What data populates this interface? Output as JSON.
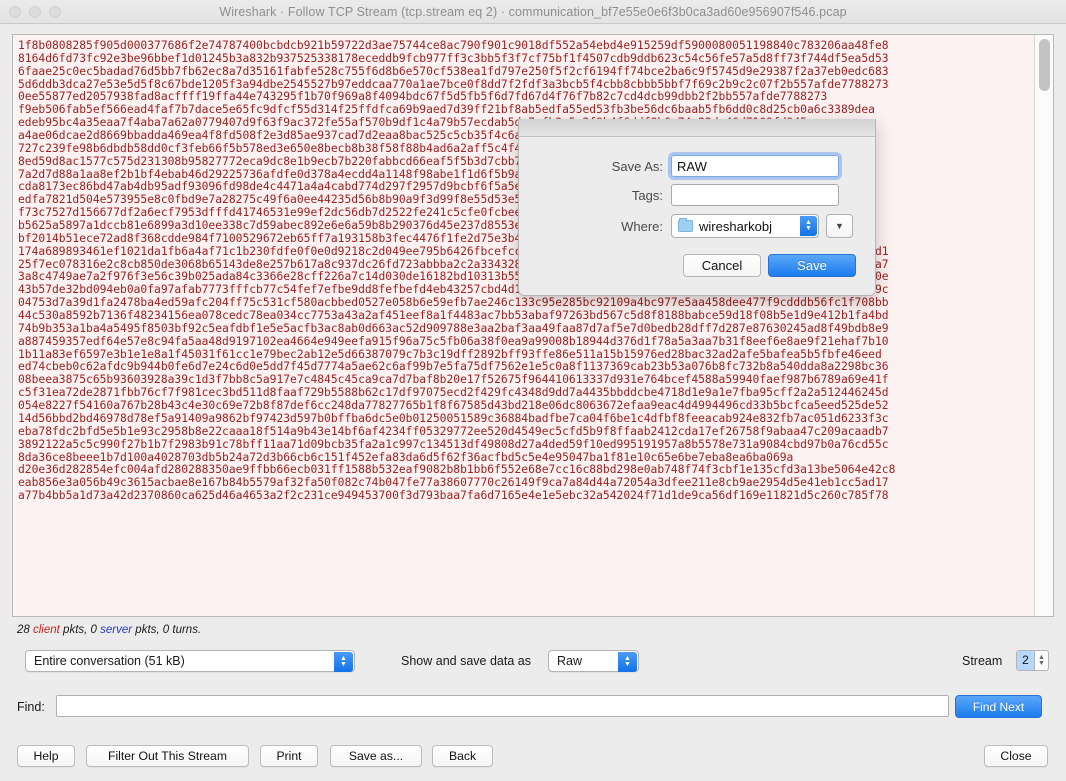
{
  "window": {
    "title": "Wireshark · Follow TCP Stream (tcp.stream eq 2) · communication_bf7e55e0e6f3b0ca3ad60e956907f546.pcap"
  },
  "stream": {
    "text_color": "#9e2020",
    "background_color": "#fdf2f2",
    "lines": [
      "1f8b0808285f905d000377686f2e74787400bcbdcb921b59722d3ae75744ce8ac790f901c9018df552a54ebd4e915259df5900080051198840c783206aa48fe8",
      "8164d6fd73fc92e3be96bbef1d01245b3a832b937525338178eceddb9fcb977ff3c3bb5f3f7cf75bf1f4507cdb9ddb623c54c56fe57a5d8ff73f744df5ea5d53",
      "6faae25c0ec5badad76d5bb7fb62ec8a7d35161fabfe528c755f6d8b6e570cf538ea1fd797e250f5f2cf6194ff74bce2ba6c9f5745d9e29387f2a37eb0edc683",
      "5d6ddb3dca27e53e5d5f8c67bde1205f3a94dbe2545527b97eddcaa770a1ae7bce0f8dd7f2fdf3a3bcb5f4cbb8cbbb5bbf7f69c2b9c2c07f2b557afde7788273",
      "0ee55877ed2057938fad8acffff19ffa44e743295f1b70f969a8f4094bdc67f5d5fb5f6d7fd67d4f76f7b82c7cd4dcb99dbb2f2bb557afde7788273",
      "f9eb506fab5ef566ead4faf7b7dace5e65fc9dfcf55d314f25ffdfca69b9aed7d39ff21bf8ab5edfa55ed53fb3be56dc6baab5fb6dd0c8d25cb0a6c3389dea",
      "edeb95bc4a35eaa7f4aba7a62a0779407d9f63f9ac372fe55af570b9df1c4a79b57ecdab5de7cfb3e5c2f9b4f6ddf8b6e74c22de46d7109fd945e",
      "a4ae06dcae2d8669bbadda469ea4f8fd508f2e3d85ae937cad7d2eaa8bac525c5cb35f4c6a7e7ffddcffb3f5f7c7b27f2ef5516a15a0",
      "727c239fe98b6dbdb58dd0cf3feb66f5b578ed3e650e8becb8b38f58f88b4ad6a2aff5c4f4f4fb213a56c892c4d53",
      "8ed59d8ac1577c575d231308b95827772eca9dc8e1b9ecb7b220fabbcd66eaf5f5b3d7cbb7cd44ee4cf7a7cd771928bcf887dca23e56",
      "7a2d7d88a1aa8ef2b1bf4ebab46d29225736afdfe0d378a4ecdd4a1148f98abe1f1d6f5b9ab9127b2914ff3416afb",
      "cda8173ec86bd47ab4db95adf93096fd98de4c4471a4a4cabd774d297f2957d9bcbf6f5a5e5aa5a0b2cfa4a5aa21bde58d07",
      "edfa7821d504e573955e8c0fbd9e7a28275c49f6a0ee44235d56b8b90a9f3d99f8e55d53e5cbf8b6f5b6ea8611c2a77b21b794c7d5",
      "f73c7527d156677df2a6ecf7953dfffd41746531e99ef2dc56db7d2522fe241c5cfe0fcbeef15c61b4377e621c04195e776",
      "b5625a5897a1dccb81e6899a3d10ee338c7d59abec892e6e6a59b8b290376d45e237d8553e3f95ad3c82",
      "bf2014b51ece72ad8f368cdde984f7100529672eb65ff7a193158b3fec4476f1fe2d75e3b4a1c5be5bb90105c53ff640ab23b37",
      "174a689893461ef1021da1fb6a4af71c1b230fdfe0f0e0d9218c2d049ee795b6426fbcefcc741d4a59ac5636efd3f8507c5ff7c348911b7178fc7a7c27b9d4d1",
      "25f7ec078316e2c8cb850de3068b65143de8e257b617a8c937dc26fd723abbba2c2a3343284059086eaa6c8fec949d45f99308b82ade5ddd34f25b3b2fa775a7",
      "3a8c4749ae7a2f976f3e56c39b025ada84c3366e28cff226a7c14d030de16182bd10313b55fbe1a178afcb90debef84354f1aeef8e2288953fa5ddc577e2540e",
      "43b57de32bd094eb0a0fa97afab7773fffcb77c54fef7efbe9dd8fefbefd4eb43257cbd4d15edc00d9c57a900d91cd19218c769dea781a2f8fb8839a1095579c",
      "04753d7a39d1fa2478ba4ed59afc204ff75c531cf580acbbed0527e058b6e59efb7ae246c133c95e285bc92109a4bc977e5aa458dee477f9cdddb56fc1f708bb",
      "44c530a8592b7136f48234156ea078cedc78ea034cc7753a43a2af451eef8a1f4483ac7bb53abaf97263bd567c5d8f8188babce59d18f08b5e1d9e412b1fa4bd",
      "74b9b353a1ba4a5495f8503bf92c5eafdbf1e5e5acfb3ac8ab0d663ac52d909788e3aa2baf3aa49faa87d7af5e7d0bedb28dff7d287e87630245ad8f49bdb8e9",
      "a887459357edf64e57e8c94fa5aa48d9197102ea4664e949eefa915f96a75c5fb06a38f0ea9a99008b18944d376d1f78a5a3aa7b31f8eef6e8ae9f21ehaf7b10",
      "1b11a83ef6597e3b1e1e8a1f45031f61cc1e79bec2ab12e5d66387079c7b3c19dff2892bff93ffe86e511a15b15976ed28bac32ad2afe5bafea5b5fbfe46eed",
      "ed74cbeb0c62afdc9b944b0fe6d7e24c6d0e5dd7f45d7774a5ae62c6af99b7e5fa75df7562e1e5c0a8f1137369cab23b53a076b8fc732b8a540dda8a2298bc36",
      "08beea3875c65b93603928a39c1d3f7bb8c5a917e7c4845c45ca9ca7d7baf8b20e17f52675f964410613337d931e764bcef4588a59940faef987b6789a69e41f",
      "c5f31ea72de2871fbb76cf7f981cec3bd511d8faaf729b5588b62c17df97075ecd2f429fc4348d9dd7a4435bbddcbe4718d1e9a1e7fba95cff2a2a512446245d",
      "054e8227f54160a767b28b43c4e30c69e72b8f87def6cc248da77827765b1f8f67585d43bd218e06dc8063672efaa9eac4d4994496cd33b5bcfca5eed525de52",
      "14d56bbd2bd46978d78ef5a91409a9862bf97423d597b0bffba6dc5e0b01250051589c36884badfbe7ca04f6be1c4dfbf8feeacab924e832fb7ac051d6233f3c",
      "eba78fdc2bfd5e5b1e93c2958b8e22caaa18f514a9b43e14bf6af4234ff05329772ee520d4549ec5cfd5b9f8ffaab2412cda17ef26758f9abaa47c209acaadb7",
      "3892122a5c5c990f27b1b7f2983b91c78bff11aa71d09bcb35fa2a1c997c134513df49808d27a4ded59f10ed995191957a8b5578e731a9084cbd97b0a76cd55c",
      "8da36ce8beee1b7d100a4028703db5b24a72d3b66cb6c151f452efa83da6d5f62f36acfbd5c5e4e95047ba1f81e10c65e6be7eba8ea6ba069a",
      "d20e36d282854efc004afd280288350ae9ffbb66ecb031ff1588b532eaf9082b8b1bb6f552e68e7cc16c88bd298e0ab748f74f3cbf1e135cfd3a13be5064e42c8",
      "eab856e3a056b49c3615acbae8e167b84b5579af32fa50f082c74b047fe77a38607770c26149f9ca7a84d44a72054a3dfee211e8cb9ae2954d5e41eb1cc5ad17",
      "a77b4bb5a1d73a42d2370860ca625d46a4653a2f2c231ce949453700f3d793baa7fa6d7165e4e1e5ebc32a542024f71d1de9ca56df169e11821d5c260c785f78"
    ]
  },
  "status": {
    "client_count": "28",
    "client_word": "client",
    "pkts_1": " pkts, ",
    "server_count": "0",
    "server_word": "server",
    "pkts_2": " pkts, 0 turns."
  },
  "controls": {
    "conversation_value": "Entire conversation (51 kB)",
    "show_save_label": "Show and save data as",
    "format_value": "Raw",
    "stream_label": "Stream",
    "stream_value": "2"
  },
  "find": {
    "label": "Find:",
    "value": "",
    "placeholder": "",
    "next_label": "Find Next"
  },
  "buttons": {
    "help": "Help",
    "filter_out": "Filter Out This Stream",
    "print": "Print",
    "save_as": "Save as...",
    "back": "Back",
    "close": "Close"
  },
  "save_sheet": {
    "save_as_label": "Save As:",
    "save_as_value": "RAW",
    "tags_label": "Tags:",
    "tags_value": "",
    "where_label": "Where:",
    "where_value": "wiresharkobj",
    "cancel_label": "Cancel",
    "save_label": "Save"
  },
  "colors": {
    "accent_blue": "#1d7cf0",
    "hex_red": "#9e2020",
    "hex_bg": "#fdf2f2",
    "chrome_gray": "#ececec"
  }
}
